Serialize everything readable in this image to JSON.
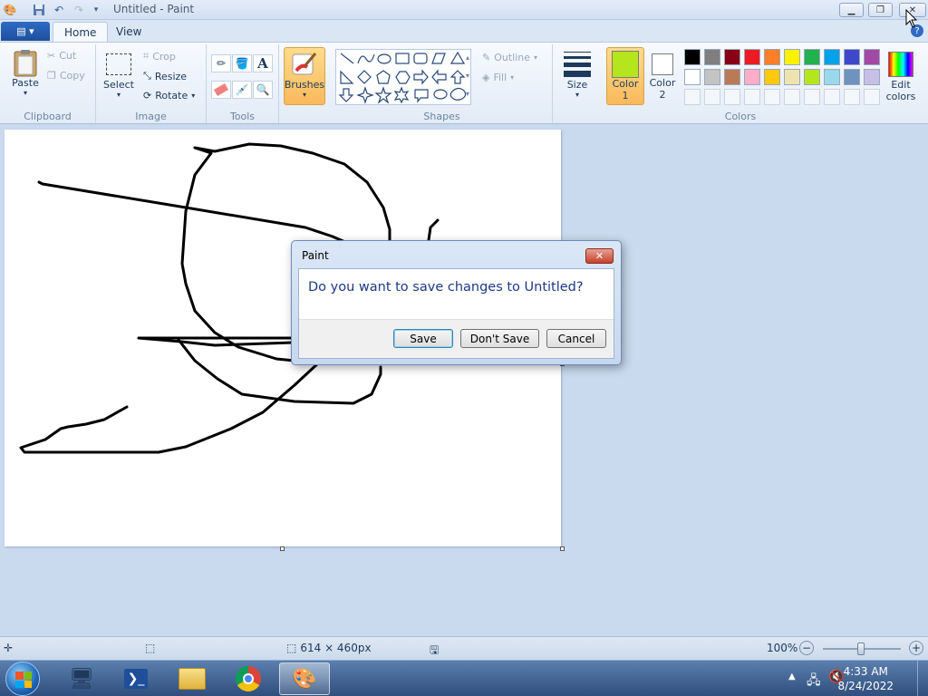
{
  "window": {
    "title": "Untitled - Paint"
  },
  "tabs": [
    {
      "label": "Home"
    },
    {
      "label": "View"
    }
  ],
  "clipboard": {
    "paste": "Paste",
    "cut": "Cut",
    "copy": "Copy",
    "group": "Clipboard"
  },
  "image": {
    "select": "Select",
    "crop": "Crop",
    "resize": "Resize",
    "rotate": "Rotate",
    "group": "Image"
  },
  "tools": {
    "group": "Tools"
  },
  "brushes": {
    "label": "Brushes"
  },
  "shapes": {
    "outline": "Outline",
    "fill": "Fill",
    "group": "Shapes"
  },
  "size": {
    "label": "Size"
  },
  "colors": {
    "color1_line1": "Color",
    "color1_line2": "1",
    "color2_line1": "Color",
    "color2_line2": "2",
    "edit_line1": "Edit",
    "edit_line2": "colors",
    "group": "Colors",
    "color1_value": "#b5e61d",
    "color2_value": "#ffffff",
    "palette_row1": [
      "#000000",
      "#7f7f7f",
      "#880015",
      "#ed1c24",
      "#ff7f27",
      "#fff200",
      "#22b14c",
      "#00a2e8",
      "#3f48cc",
      "#a349a4"
    ],
    "palette_row2": [
      "#ffffff",
      "#c3c3c3",
      "#b97a57",
      "#ffaec9",
      "#ffc90e",
      "#efe4b0",
      "#b5e61d",
      "#99d9ea",
      "#7092be",
      "#c8bfe7"
    ]
  },
  "status": {
    "canvas_size": "614 × 460px",
    "zoom": "100%"
  },
  "taskbar": {
    "time": "4:33 AM",
    "date": "8/24/2022"
  },
  "dialog": {
    "title": "Paint",
    "message": "Do you want to save changes to Untitled?",
    "save": "Save",
    "dont_save": "Don't Save",
    "cancel": "Cancel"
  }
}
